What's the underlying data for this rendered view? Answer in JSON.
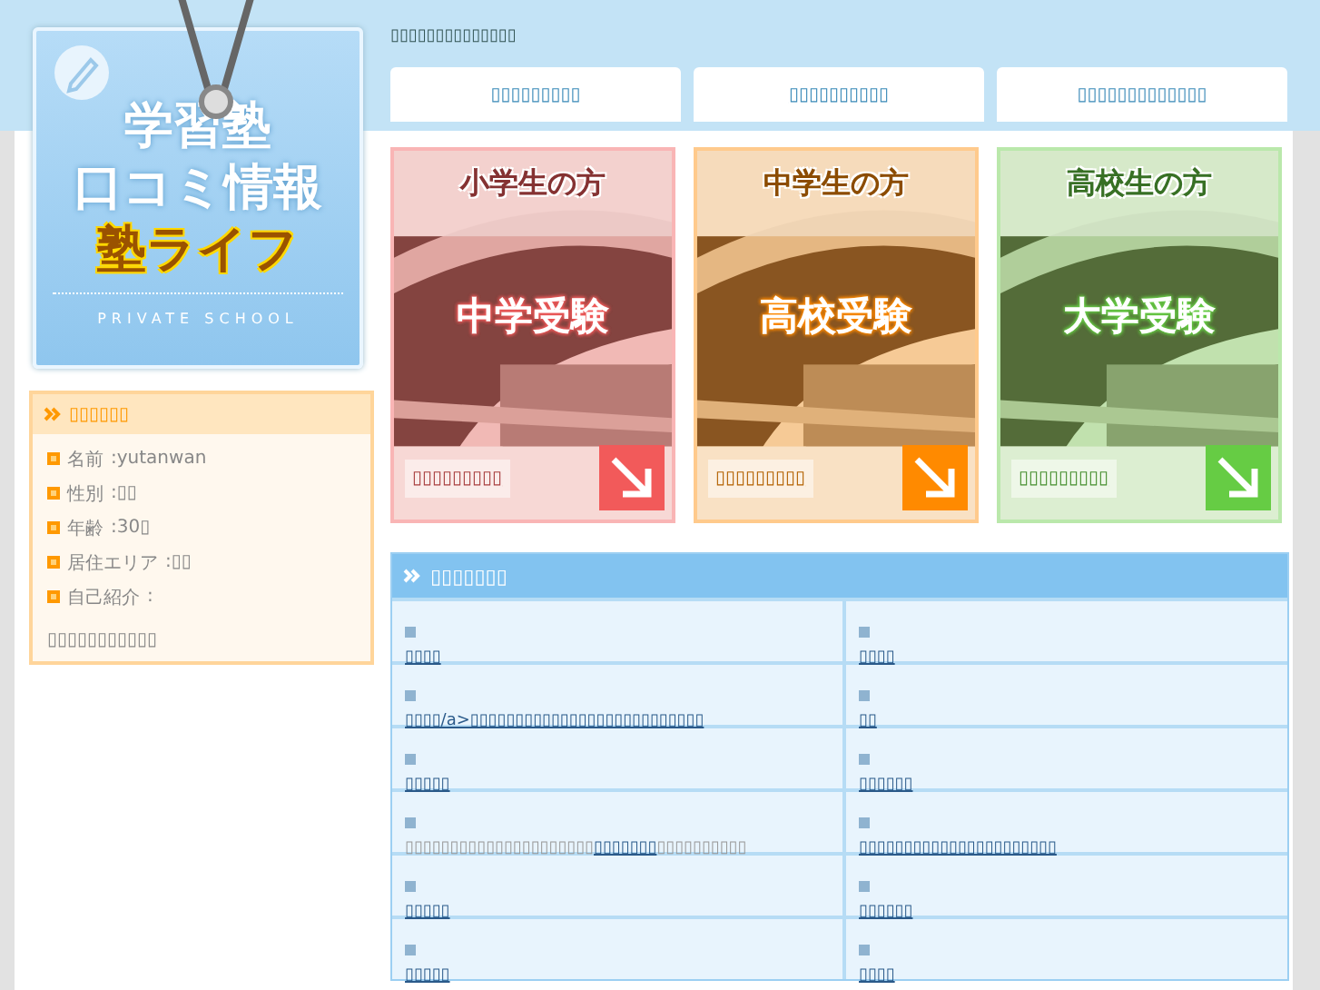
{
  "logo": {
    "lines": [
      "学習塾",
      "口コミ情報",
      "塾ライフ"
    ],
    "subtitle": "PRIVATE SCHOOL"
  },
  "header": {
    "caption": "▯▯▯▯▯▯▯▯▯▯▯▯▯▯"
  },
  "nav": [
    {
      "label": "▯▯▯▯▯▯▯▯▯"
    },
    {
      "label": "▯▯▯▯▯▯▯▯▯▯"
    },
    {
      "label": "▯▯▯▯▯▯▯▯▯▯▯▯▯"
    }
  ],
  "profile": {
    "title": "▯▯▯▯▯▯",
    "fields": [
      {
        "label": "名前",
        "value": ":yutanwan"
      },
      {
        "label": "性別",
        "value": ":▯▯"
      },
      {
        "label": "年齢",
        "value": ":30▯"
      },
      {
        "label": "居住エリア",
        "value": ":▯▯"
      },
      {
        "label": "自己紹介",
        "value": ":"
      }
    ],
    "intro": "▯▯▯▯▯▯▯▯▯▯▯"
  },
  "cards": [
    {
      "audience": "小学生の方",
      "exam": "中学受験",
      "link": "▯▯▯▯▯▯▯▯▯",
      "color": "#f25a5a"
    },
    {
      "audience": "中学生の方",
      "exam": "高校受験",
      "link": "▯▯▯▯▯▯▯▯▯",
      "color": "#ff8a00"
    },
    {
      "audience": "高校生の方",
      "exam": "大学受験",
      "link": "▯▯▯▯▯▯▯▯▯",
      "color": "#66cc44"
    }
  ],
  "table": {
    "title": "▯▯▯▯▯▯▯",
    "rows": [
      [
        {
          "parts": [
            {
              "text": "▯▯▯▯",
              "link": true
            }
          ]
        },
        {
          "parts": [
            {
              "text": "▯▯▯▯",
              "link": true
            }
          ]
        }
      ],
      [
        {
          "parts": [
            {
              "text": "▯▯▯▯/a>▯▯▯▯▯▯▯▯▯▯▯▯▯▯▯▯▯▯▯▯▯▯▯▯▯▯",
              "link": true
            }
          ]
        },
        {
          "parts": [
            {
              "text": "▯▯",
              "link": true
            }
          ]
        }
      ],
      [
        {
          "parts": [
            {
              "text": "▯▯▯▯▯",
              "link": true
            }
          ]
        },
        {
          "parts": [
            {
              "text": "▯▯▯▯▯▯",
              "link": true
            }
          ]
        }
      ],
      [
        {
          "parts": [
            {
              "text": "▯▯▯▯▯▯▯▯▯▯▯▯▯▯▯▯▯▯▯▯▯",
              "link": false
            },
            {
              "text": "▯▯▯▯▯▯▯",
              "link": true
            },
            {
              "text": "▯▯▯▯▯▯▯▯▯▯",
              "link": false
            }
          ]
        },
        {
          "parts": [
            {
              "text": "▯▯▯▯▯▯▯▯▯▯▯▯▯▯▯▯▯▯▯▯▯▯",
              "link": true
            }
          ]
        }
      ],
      [
        {
          "parts": [
            {
              "text": "▯▯▯▯▯",
              "link": true
            }
          ]
        },
        {
          "parts": [
            {
              "text": "▯▯▯▯▯▯",
              "link": true
            }
          ]
        }
      ],
      [
        {
          "parts": [
            {
              "text": "▯▯▯▯▯",
              "link": true
            }
          ]
        },
        {
          "parts": [
            {
              "text": "▯▯▯▯",
              "link": true
            }
          ]
        }
      ]
    ]
  }
}
